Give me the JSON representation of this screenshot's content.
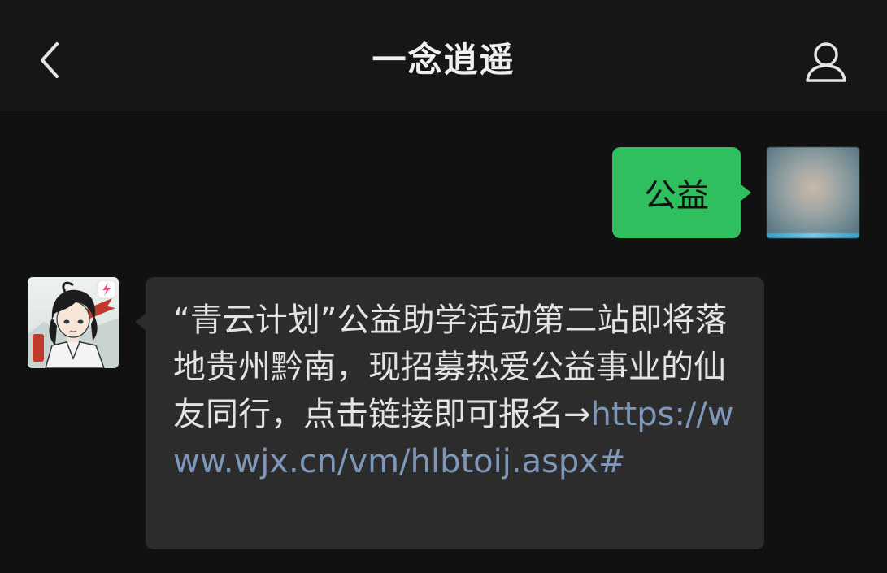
{
  "header": {
    "title": "一念逍遥",
    "back_icon": "chevron-left-icon",
    "profile_icon": "person-icon"
  },
  "messages": [
    {
      "direction": "outgoing",
      "text": "公益",
      "bubble_color": "#2fbf5e"
    },
    {
      "direction": "incoming",
      "text": "“青云计划”公益助学活动第二站即将落地贵州黔南，现招募热爱公益事业的仙友同行，点击链接即可报名→",
      "link": "https://www.wjx.cn/vm/hlbtoij.aspx#",
      "link_color": "#7f97b8",
      "bubble_color": "#2c2c2c"
    }
  ],
  "theme": {
    "background": "#111111",
    "header_background": "#161616",
    "text_color": "#e6e6e6"
  }
}
